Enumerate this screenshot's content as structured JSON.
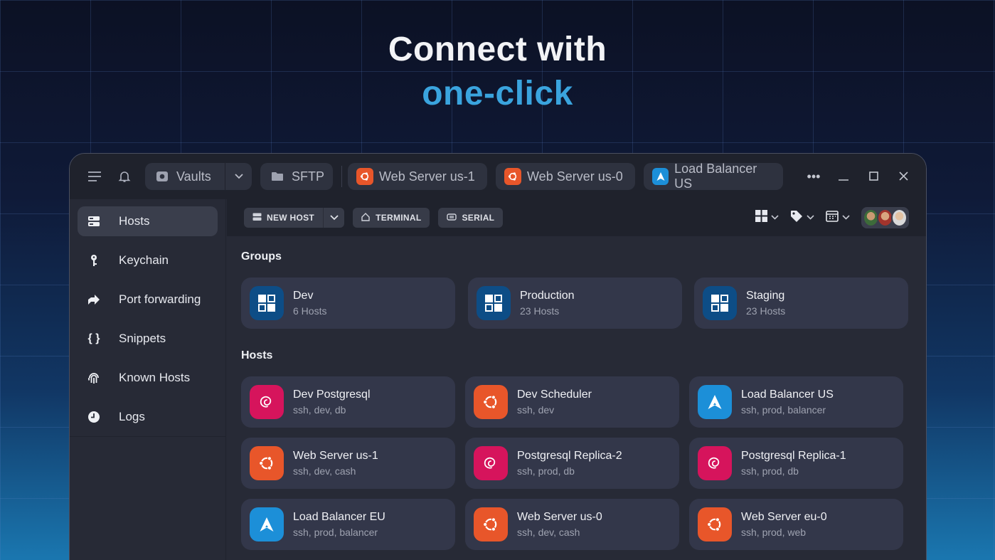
{
  "hero": {
    "line1": "Connect with",
    "line2": "one-click"
  },
  "titlebar": {
    "vaults_label": "Vaults",
    "tabs": [
      {
        "label": "SFTP",
        "icon": "folder-icon"
      },
      {
        "label": "Web Server us-1",
        "icon": "ubuntu-icon"
      },
      {
        "label": "Web Server us-0",
        "icon": "ubuntu-icon"
      },
      {
        "label": "Load Balancer US",
        "icon": "arch-icon"
      }
    ]
  },
  "sidebar": {
    "items": [
      {
        "label": "Hosts",
        "icon": "server-icon",
        "active": true
      },
      {
        "label": "Keychain",
        "icon": "key-icon"
      },
      {
        "label": "Port forwarding",
        "icon": "arrow-forward-icon"
      },
      {
        "label": "Snippets",
        "icon": "braces-icon"
      },
      {
        "label": "Known Hosts",
        "icon": "fingerprint-icon"
      },
      {
        "label": "Logs",
        "icon": "clock-icon"
      }
    ]
  },
  "toolbar": {
    "new_host": "NEW HOST",
    "terminal": "TERMINAL",
    "serial": "SERIAL"
  },
  "groups": {
    "title": "Groups",
    "items": [
      {
        "name": "Dev",
        "count": "6 Hosts"
      },
      {
        "name": "Production",
        "count": "23 Hosts"
      },
      {
        "name": "Staging",
        "count": "23 Hosts"
      }
    ]
  },
  "hosts": {
    "title": "Hosts",
    "items": [
      {
        "name": "Dev Postgresql",
        "tags": "ssh, dev, db",
        "os": "debian"
      },
      {
        "name": "Dev Scheduler",
        "tags": "ssh, dev",
        "os": "ubuntu"
      },
      {
        "name": "Load Balancer US",
        "tags": "ssh, prod, balancer",
        "os": "arch"
      },
      {
        "name": "Web Server us-1",
        "tags": "ssh, dev, cash",
        "os": "ubuntu"
      },
      {
        "name": "Postgresql Replica-2",
        "tags": "ssh, prod, db",
        "os": "debian"
      },
      {
        "name": "Postgresql Replica-1",
        "tags": "ssh, prod, db",
        "os": "debian"
      },
      {
        "name": "Load Balancer EU",
        "tags": "ssh, prod, balancer",
        "os": "arch"
      },
      {
        "name": "Web Server us-0",
        "tags": "ssh, dev, cash",
        "os": "ubuntu"
      },
      {
        "name": "Web Server eu-0",
        "tags": "ssh, prod, web",
        "os": "ubuntu"
      }
    ]
  },
  "colors": {
    "accent": "#3aa4de",
    "debian": "#d6145c",
    "ubuntu": "#e8562a",
    "arch": "#1c8fd8",
    "group": "#0d4d86"
  }
}
